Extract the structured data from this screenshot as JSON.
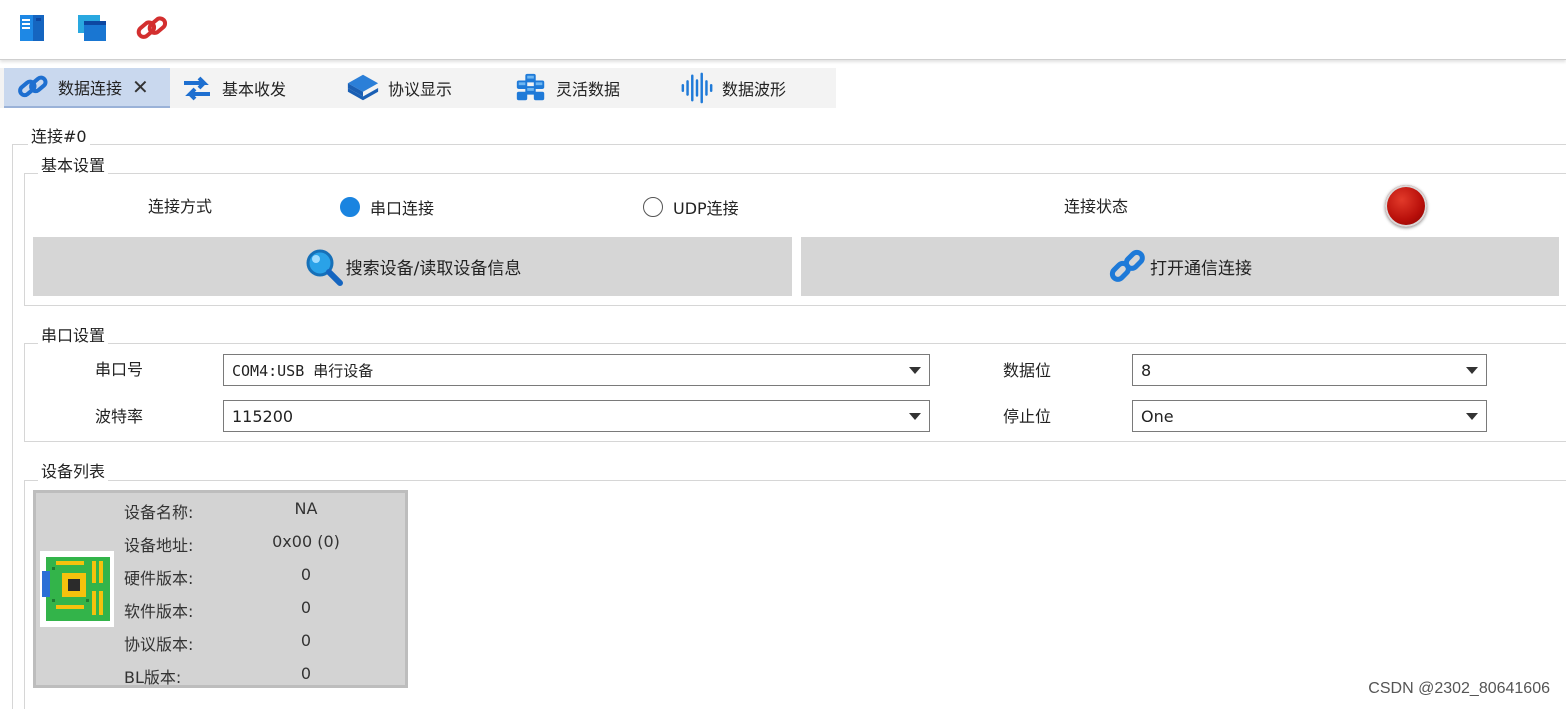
{
  "toolbar": {
    "buttons": [
      {
        "icon": "book-icon"
      },
      {
        "icon": "windows-icon"
      },
      {
        "icon": "link-icon"
      }
    ]
  },
  "tabs": [
    {
      "label": "数据连接",
      "icon": "link-icon",
      "active": true,
      "closable": true
    },
    {
      "label": "基本收发",
      "icon": "arrows-icon",
      "active": false
    },
    {
      "label": "协议显示",
      "icon": "layers-icon",
      "active": false
    },
    {
      "label": "灵活数据",
      "icon": "cubes-icon",
      "active": false
    },
    {
      "label": "数据波形",
      "icon": "waveform-icon",
      "active": false
    }
  ],
  "connection": {
    "title": "连接#0",
    "basic": {
      "title": "基本设置",
      "mode_label": "连接方式",
      "options": [
        {
          "label": "串口连接",
          "selected": true
        },
        {
          "label": "UDP连接",
          "selected": false
        }
      ],
      "status_label": "连接状态",
      "status_color": "#c0160f",
      "search_button": "搜索设备/读取设备信息",
      "open_button": "打开通信连接"
    },
    "serial": {
      "title": "串口设置",
      "port_label": "串口号",
      "port_value": "COM4:USB 串行设备",
      "baud_label": "波特率",
      "baud_value": "115200",
      "databits_label": "数据位",
      "databits_value": "8",
      "stopbits_label": "停止位",
      "stopbits_value": "One"
    },
    "devices": {
      "title": "设备列表",
      "items": [
        {
          "fields": [
            {
              "key": "设备名称:",
              "value": "NA"
            },
            {
              "key": "设备地址:",
              "value": "0x00 (0)"
            },
            {
              "key": "硬件版本:",
              "value": "0"
            },
            {
              "key": "软件版本:",
              "value": "0"
            },
            {
              "key": "协议版本:",
              "value": "0"
            },
            {
              "key": "BL版本:",
              "value": "0"
            }
          ]
        }
      ]
    }
  },
  "watermark": "CSDN @2302_80641606"
}
